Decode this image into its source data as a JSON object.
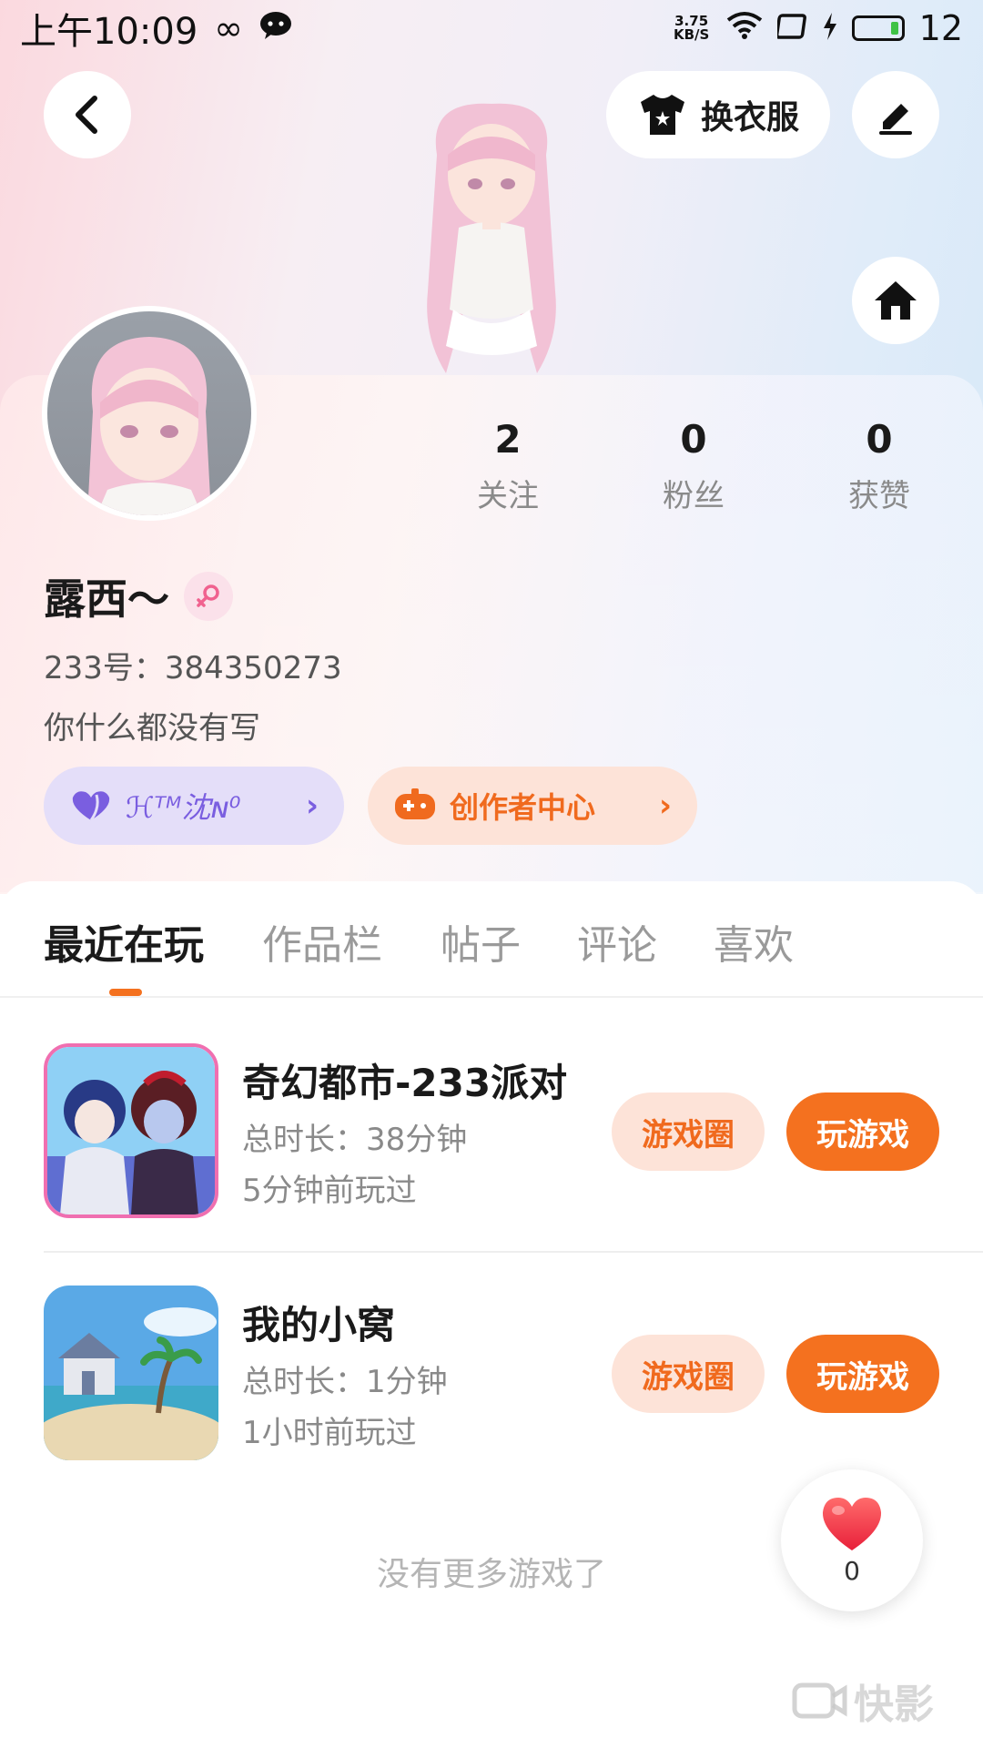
{
  "status_bar": {
    "time": "上午10:09",
    "infinity_symbol": "∞",
    "net_speed_value": "3.75",
    "net_speed_unit": "KB/S",
    "battery_level": "12"
  },
  "header": {
    "dress_button_label": "换衣服"
  },
  "profile": {
    "stats": [
      {
        "value": "2",
        "label": "关注"
      },
      {
        "value": "0",
        "label": "粉丝"
      },
      {
        "value": "0",
        "label": "获赞"
      }
    ],
    "username": "露西～",
    "gender": "female",
    "uid": "233号：384350273",
    "bio": "你什么都没有写",
    "badge_label": "ℋᵀᴹ沈ɴ⁰",
    "creator_center_label": "创作者中心"
  },
  "tabs": [
    {
      "label": "最近在玩",
      "active": true
    },
    {
      "label": "作品栏",
      "active": false
    },
    {
      "label": "帖子",
      "active": false
    },
    {
      "label": "评论",
      "active": false
    },
    {
      "label": "喜欢",
      "active": false
    }
  ],
  "games": [
    {
      "title": "奇幻都市-233派对",
      "duration": "总时长：38分钟",
      "last_played": "5分钟前玩过",
      "circle_label": "游戏圈",
      "play_label": "玩游戏"
    },
    {
      "title": "我的小窝",
      "duration": "总时长：1分钟",
      "last_played": "1小时前玩过",
      "circle_label": "游戏圈",
      "play_label": "玩游戏"
    }
  ],
  "list_footer": "没有更多游戏了",
  "like_button": {
    "count": "0"
  },
  "watermark": "快影",
  "colors": {
    "accent": "#f4711f",
    "accent_light": "#fde3d8",
    "badge_purple": "#7a5ee0"
  }
}
